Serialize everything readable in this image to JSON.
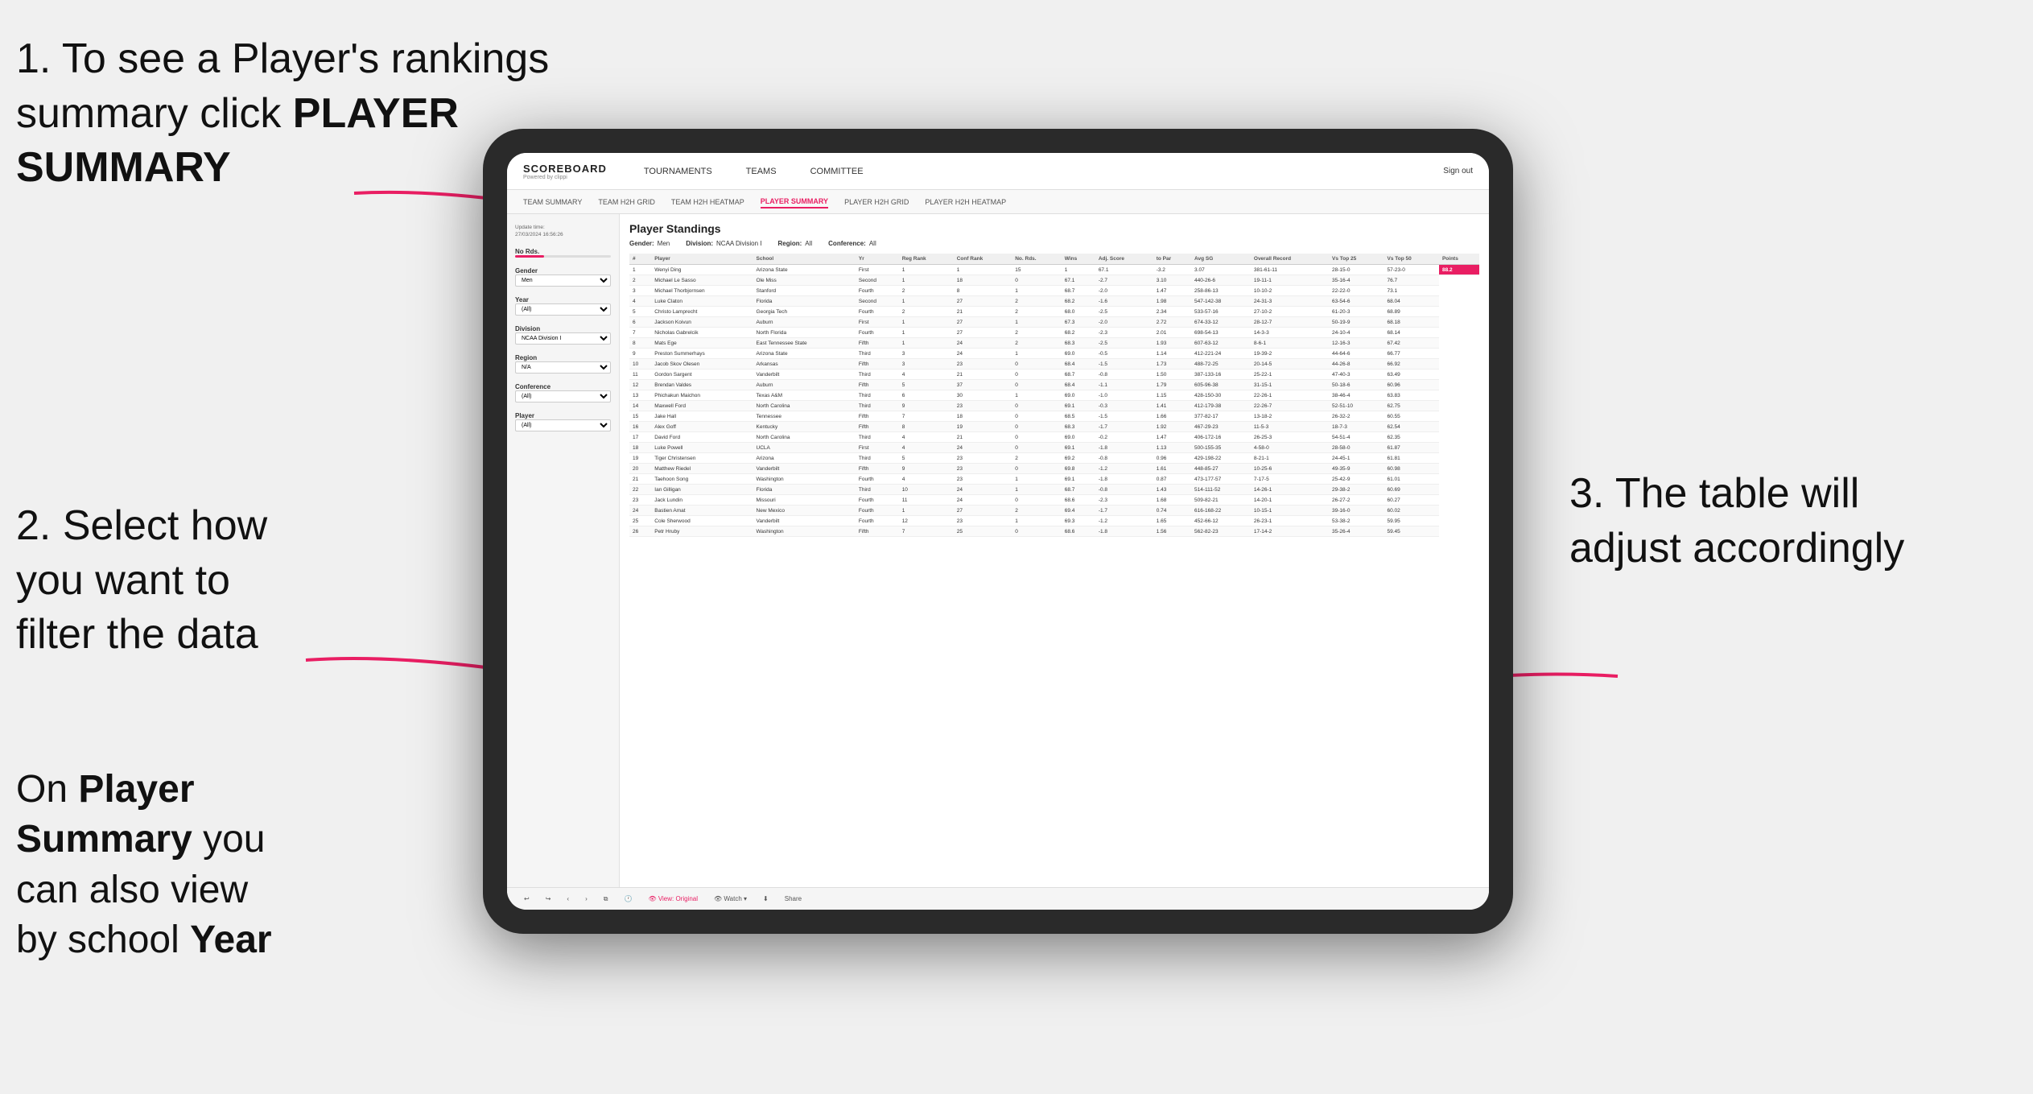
{
  "annotations": {
    "ann1_line1": "1. To see a Player's rankings",
    "ann1_line2": "summary click ",
    "ann1_bold": "PLAYER SUMMARY",
    "ann2_line1": "2. Select how",
    "ann2_line2": "you want to",
    "ann2_line3": "filter the data",
    "ann3_line1": "3. The table will",
    "ann3_line2": "adjust accordingly",
    "ann_bottom_line1": "On ",
    "ann_bottom_bold1": "Player",
    "ann_bottom_line2": "Summary",
    "ann_bottom_normal": " you",
    "ann_bottom_line3": "can also view",
    "ann_bottom_line4": "by school ",
    "ann_bottom_bold2": "Year"
  },
  "nav": {
    "logo": "SCOREBOARD",
    "logo_sub": "Powered by clippi",
    "items": [
      "TOURNAMENTS",
      "TEAMS",
      "COMMITTEE"
    ],
    "sign_in": "Sign out"
  },
  "sub_nav": {
    "items": [
      "TEAM SUMMARY",
      "TEAM H2H GRID",
      "TEAM H2H HEATMAP",
      "PLAYER SUMMARY",
      "PLAYER H2H GRID",
      "PLAYER H2H HEATMAP"
    ],
    "active": "PLAYER SUMMARY"
  },
  "filters": {
    "update_label": "Update time:",
    "update_value": "27/03/2024 16:56:26",
    "gender_label": "Gender",
    "gender_value": "Men",
    "year_label": "Year",
    "year_value": "(All)",
    "division_label": "Division",
    "division_value": "NCAA Division I",
    "region_label": "Region",
    "region_value": "N/A",
    "conference_label": "Conference",
    "conference_value": "(All)",
    "player_label": "Player",
    "player_value": "(All)"
  },
  "table": {
    "title": "Player Standings",
    "header_filters": [
      {
        "label": "Gender:",
        "value": "Men"
      },
      {
        "label": "Division:",
        "value": "NCAA Division I"
      },
      {
        "label": "Region:",
        "value": "All"
      },
      {
        "label": "Conference:",
        "value": "All"
      }
    ],
    "columns": [
      "#",
      "Player",
      "School",
      "Yr",
      "Reg Rank",
      "Conf Rank",
      "No. Rds.",
      "Wins",
      "Adj. Score to Par",
      "Avg SG",
      "Overall Record",
      "Vs Top 25",
      "Vs Top 50",
      "Points"
    ],
    "rows": [
      [
        "1",
        "Wenyi Ding",
        "Arizona State",
        "First",
        "1",
        "1",
        "15",
        "1",
        "67.1",
        "-3.2",
        "3.07",
        "381-61-11",
        "28-15-0",
        "57-23-0",
        "88.2"
      ],
      [
        "2",
        "Michael Le Sasso",
        "Ole Miss",
        "Second",
        "1",
        "18",
        "0",
        "67.1",
        "-2.7",
        "3.10",
        "440-26-6",
        "19-11-1",
        "35-16-4",
        "76.7"
      ],
      [
        "3",
        "Michael Thorbjornsen",
        "Stanford",
        "Fourth",
        "2",
        "8",
        "1",
        "68.7",
        "-2.0",
        "1.47",
        "258-86-13",
        "10-10-2",
        "22-22-0",
        "73.1"
      ],
      [
        "4",
        "Luke Claton",
        "Florida",
        "Second",
        "1",
        "27",
        "2",
        "68.2",
        "-1.6",
        "1.98",
        "547-142-38",
        "24-31-3",
        "63-54-6",
        "68.04"
      ],
      [
        "5",
        "Christo Lamprecht",
        "Georgia Tech",
        "Fourth",
        "2",
        "21",
        "2",
        "68.0",
        "-2.5",
        "2.34",
        "533-57-16",
        "27-10-2",
        "61-20-3",
        "68.89"
      ],
      [
        "6",
        "Jackson Koivun",
        "Auburn",
        "First",
        "1",
        "27",
        "1",
        "67.3",
        "-2.0",
        "2.72",
        "674-33-12",
        "28-12-7",
        "50-19-9",
        "68.18"
      ],
      [
        "7",
        "Nicholas Gabrelcik",
        "North Florida",
        "Fourth",
        "1",
        "27",
        "2",
        "68.2",
        "-2.3",
        "2.01",
        "698-54-13",
        "14-3-3",
        "24-10-4",
        "68.14"
      ],
      [
        "8",
        "Mats Ege",
        "East Tennessee State",
        "Fifth",
        "1",
        "24",
        "2",
        "68.3",
        "-2.5",
        "1.93",
        "607-63-12",
        "8-6-1",
        "12-16-3",
        "67.42"
      ],
      [
        "9",
        "Preston Summerhays",
        "Arizona State",
        "Third",
        "3",
        "24",
        "1",
        "69.0",
        "-0.5",
        "1.14",
        "412-221-24",
        "19-39-2",
        "44-64-6",
        "66.77"
      ],
      [
        "10",
        "Jacob Skov Olesen",
        "Arkansas",
        "Fifth",
        "3",
        "23",
        "0",
        "68.4",
        "-1.5",
        "1.73",
        "488-72-25",
        "20-14-5",
        "44-26-8",
        "66.92"
      ],
      [
        "11",
        "Gordon Sargent",
        "Vanderbilt",
        "Third",
        "4",
        "21",
        "0",
        "68.7",
        "-0.8",
        "1.50",
        "387-133-16",
        "25-22-1",
        "47-40-3",
        "63.49"
      ],
      [
        "12",
        "Brendan Valdes",
        "Auburn",
        "Fifth",
        "5",
        "37",
        "0",
        "68.4",
        "-1.1",
        "1.79",
        "605-96-38",
        "31-15-1",
        "50-18-6",
        "60.96"
      ],
      [
        "13",
        "Phichakun Maichon",
        "Texas A&M",
        "Third",
        "6",
        "30",
        "1",
        "69.0",
        "-1.0",
        "1.15",
        "428-150-30",
        "22-26-1",
        "38-46-4",
        "63.83"
      ],
      [
        "14",
        "Maxwell Ford",
        "North Carolina",
        "Third",
        "9",
        "23",
        "0",
        "69.1",
        "-0.3",
        "1.41",
        "412-179-38",
        "22-26-7",
        "52-51-10",
        "62.75"
      ],
      [
        "15",
        "Jake Hall",
        "Tennessee",
        "Fifth",
        "7",
        "18",
        "0",
        "68.5",
        "-1.5",
        "1.66",
        "377-82-17",
        "13-18-2",
        "26-32-2",
        "60.55"
      ],
      [
        "16",
        "Alex Goff",
        "Kentucky",
        "Fifth",
        "8",
        "19",
        "0",
        "68.3",
        "-1.7",
        "1.92",
        "467-29-23",
        "11-5-3",
        "18-7-3",
        "62.54"
      ],
      [
        "17",
        "David Ford",
        "North Carolina",
        "Third",
        "4",
        "21",
        "0",
        "69.0",
        "-0.2",
        "1.47",
        "406-172-16",
        "26-25-3",
        "54-51-4",
        "62.35"
      ],
      [
        "18",
        "Luke Powell",
        "UCLA",
        "First",
        "4",
        "24",
        "0",
        "69.1",
        "-1.8",
        "1.13",
        "500-155-35",
        "4-58-0",
        "28-58-0",
        "61.87"
      ],
      [
        "19",
        "Tiger Christensen",
        "Arizona",
        "Third",
        "5",
        "23",
        "2",
        "69.2",
        "-0.8",
        "0.96",
        "429-198-22",
        "8-21-1",
        "24-45-1",
        "61.81"
      ],
      [
        "20",
        "Matthew Riedel",
        "Vanderbilt",
        "Fifth",
        "9",
        "23",
        "0",
        "69.8",
        "-1.2",
        "1.61",
        "448-85-27",
        "10-25-6",
        "49-35-9",
        "60.98"
      ],
      [
        "21",
        "Taehoon Song",
        "Washington",
        "Fourth",
        "4",
        "23",
        "1",
        "69.1",
        "-1.8",
        "0.87",
        "473-177-57",
        "7-17-5",
        "25-42-9",
        "61.01"
      ],
      [
        "22",
        "Ian Gilligan",
        "Florida",
        "Third",
        "10",
        "24",
        "1",
        "68.7",
        "-0.8",
        "1.43",
        "514-111-52",
        "14-26-1",
        "29-38-2",
        "60.69"
      ],
      [
        "23",
        "Jack Lundin",
        "Missouri",
        "Fourth",
        "11",
        "24",
        "0",
        "68.6",
        "-2.3",
        "1.68",
        "509-82-21",
        "14-20-1",
        "26-27-2",
        "60.27"
      ],
      [
        "24",
        "Bastien Amat",
        "New Mexico",
        "Fourth",
        "1",
        "27",
        "2",
        "69.4",
        "-1.7",
        "0.74",
        "616-168-22",
        "10-15-1",
        "39-16-0",
        "60.02"
      ],
      [
        "25",
        "Cole Sherwood",
        "Vanderbilt",
        "Fourth",
        "12",
        "23",
        "1",
        "69.3",
        "-1.2",
        "1.65",
        "452-66-12",
        "26-23-1",
        "53-38-2",
        "59.95"
      ],
      [
        "26",
        "Petr Hruby",
        "Washington",
        "Fifth",
        "7",
        "25",
        "0",
        "68.6",
        "-1.8",
        "1.56",
        "562-82-23",
        "17-14-2",
        "35-26-4",
        "59.45"
      ]
    ]
  },
  "toolbar": {
    "view_label": "View: Original",
    "watch_label": "Watch",
    "share_label": "Share"
  }
}
